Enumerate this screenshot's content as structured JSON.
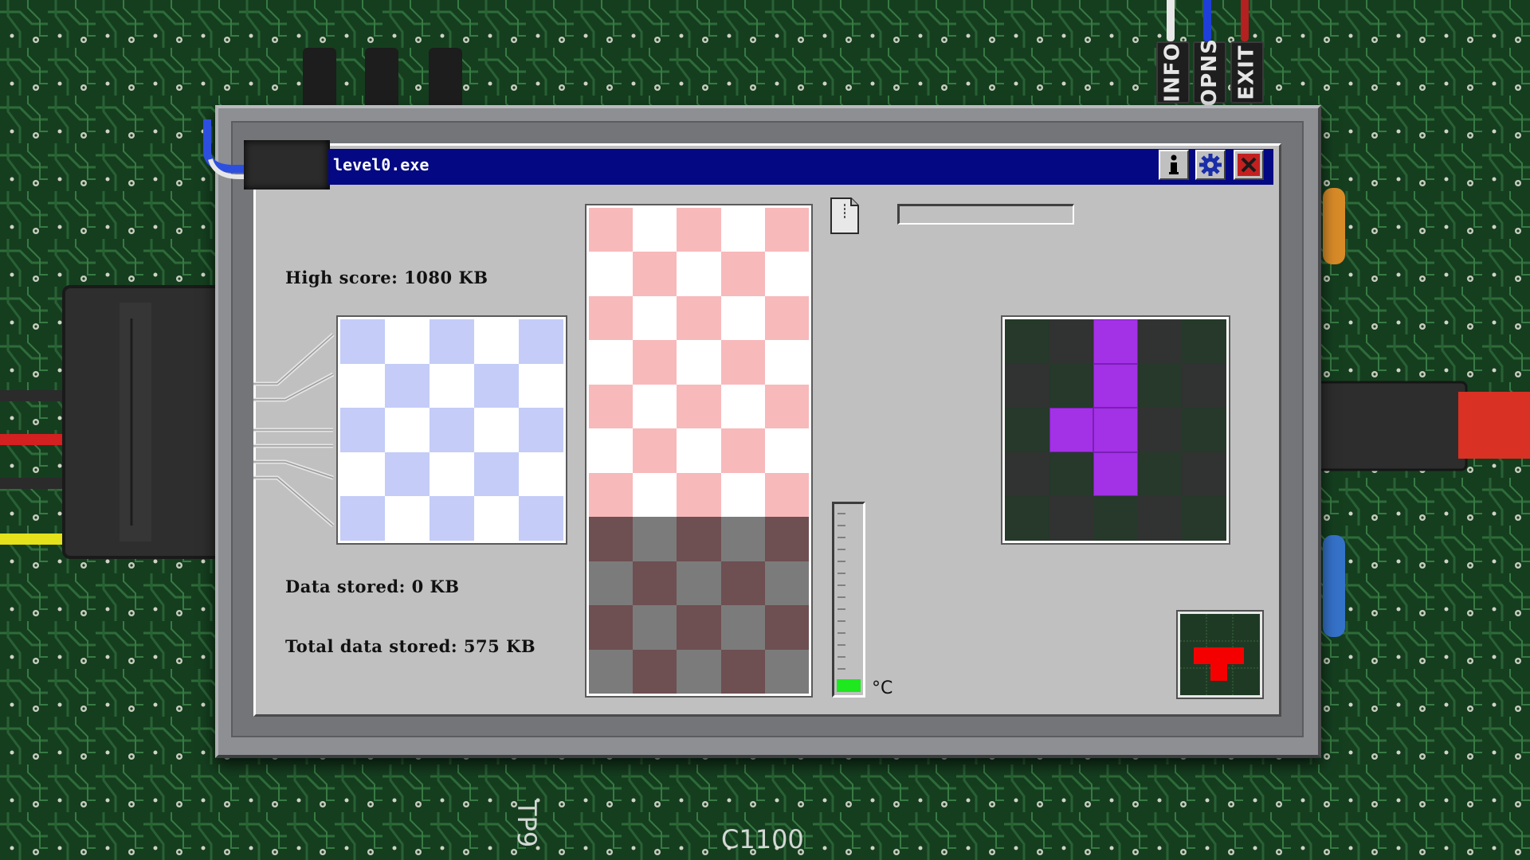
{
  "tabs": [
    {
      "label": "INFO"
    },
    {
      "label": "OPNS"
    },
    {
      "label": "EXIT"
    }
  ],
  "window": {
    "title": "level0.exe",
    "buttons": {
      "info_icon": "info-icon",
      "settings_icon": "gear-icon",
      "close_icon": "close-icon"
    }
  },
  "stats": {
    "high_score": "High score: 1080 KB",
    "data_stored": "Data stored: 0 KB",
    "total_data_stored": "Total data stored: 575 KB"
  },
  "temperature": {
    "unit": "°C",
    "level_fraction": 0.07
  },
  "progress_fraction": 0,
  "colors": {
    "board_pink": "#f8b9bb",
    "board_white": "#ffffff",
    "board_dark_a": "#7b7b7b",
    "board_dark_b": "#6e4f52",
    "storage_blue": "#c4ccf7",
    "next_dark_a": "#26392a",
    "next_dark_b": "#313232",
    "piece_purple": "#a331e6",
    "hold_red": "#f40000",
    "thermo_green": "#1ee81e",
    "titlebar": "#040883"
  },
  "board": {
    "columns": 5,
    "rows": 11,
    "empty_rows": 7,
    "filled_rows": 4
  },
  "next_piece": {
    "cells": [
      [
        0,
        2
      ],
      [
        1,
        2
      ],
      [
        2,
        1
      ],
      [
        2,
        2
      ],
      [
        3,
        2
      ]
    ]
  },
  "hold_piece": {
    "shape": "T"
  }
}
